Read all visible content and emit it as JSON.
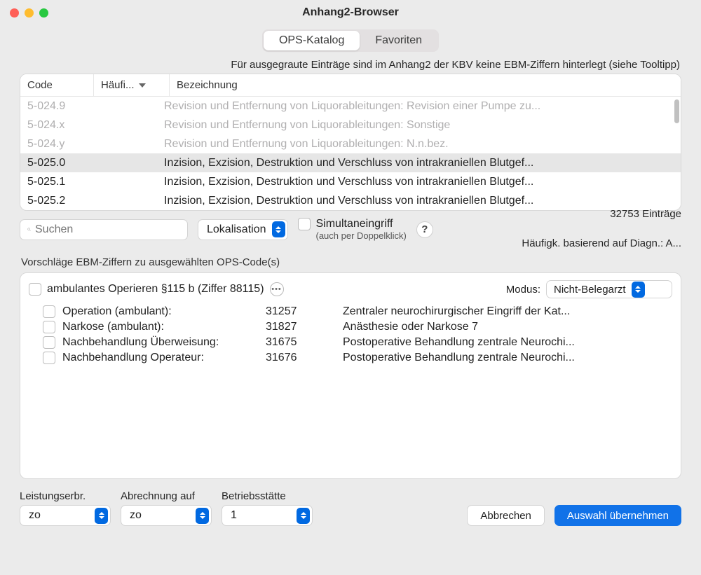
{
  "window_title": "Anhang2-Browser",
  "tabs": {
    "ops": "OPS-Katalog",
    "fav": "Favoriten"
  },
  "hint": "Für ausgegraute Einträge sind im Anhang2 der KBV  keine EBM-Ziffern hinterlegt (siehe Tooltipp)",
  "columns": {
    "code": "Code",
    "freq": "Häufi...",
    "bez": "Bezeichnung"
  },
  "rows": [
    {
      "code": "5-024.9",
      "bez": "Revision und Entfernung von Liquorableitungen: Revision einer Pumpe zu...",
      "grey": true
    },
    {
      "code": "5-024.x",
      "bez": "Revision und Entfernung von Liquorableitungen: Sonstige",
      "grey": true
    },
    {
      "code": "5-024.y",
      "bez": "Revision und Entfernung von Liquorableitungen: N.n.bez.",
      "grey": true
    },
    {
      "code": "5-025.0",
      "bez": "Inzision, Exzision, Destruktion und Verschluss von intrakraniellen Blutgef...",
      "selected": true
    },
    {
      "code": "5-025.1",
      "bez": "Inzision, Exzision, Destruktion und Verschluss von intrakraniellen Blutgef..."
    },
    {
      "code": "5-025.2",
      "bez": "Inzision, Exzision, Destruktion und Verschluss von intrakraniellen Blutgef..."
    }
  ],
  "search_placeholder": "Suchen",
  "lokalisation_label": "Lokalisation",
  "simultaneingriff_label": "Simultaneingriff",
  "simultaneingriff_sub": "(auch per Doppelklick)",
  "entry_count": "32753 Einträge",
  "freq_basis": "Häufigk. basierend auf Diagn.: A...",
  "subheader": "Vorschläge EBM-Ziffern zu ausgewählten OPS-Code(s)",
  "amb_op_title": "ambulantes Operieren §115 b (Ziffer 88115)",
  "modus_label": "Modus:",
  "modus_value": "Nicht-Belegarzt",
  "ebm_rows": [
    {
      "label": "Operation (ambulant):",
      "code": "31257",
      "desc": "Zentraler neurochirurgischer Eingriff der Kat..."
    },
    {
      "label": "Narkose (ambulant):",
      "code": "31827",
      "desc": "Anästhesie oder Narkose 7"
    },
    {
      "label": "Nachbehandlung Überweisung:",
      "code": "31675",
      "desc": "Postoperative Behandlung zentrale Neurochi..."
    },
    {
      "label": "Nachbehandlung Operateur:",
      "code": "31676",
      "desc": "Postoperative Behandlung zentrale Neurochi..."
    }
  ],
  "footer": {
    "leistungserbr_label": "Leistungserbr.",
    "leistungserbr_value": "zo",
    "abrechnung_label": "Abrechnung auf",
    "abrechnung_value": "zo",
    "betriebs_label": "Betriebsstätte",
    "betriebs_value": "1",
    "cancel": "Abbrechen",
    "apply": "Auswahl übernehmen"
  }
}
